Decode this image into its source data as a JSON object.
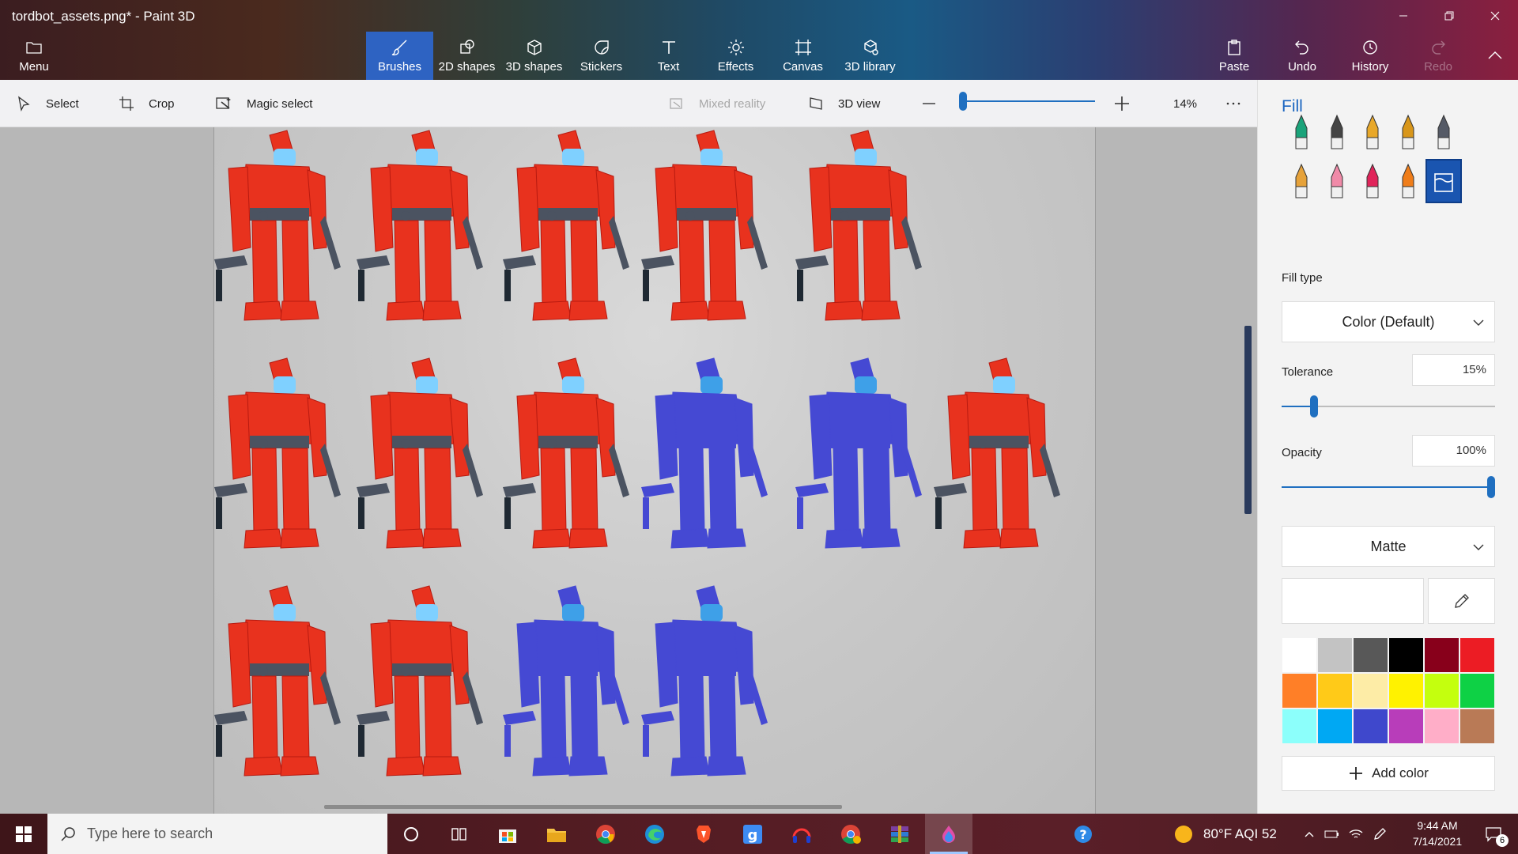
{
  "window": {
    "title": "tordbot_assets.png* - Paint 3D",
    "controls": [
      "minimize-icon",
      "restore-icon",
      "close-icon"
    ]
  },
  "ribbon": {
    "menu_label": "Menu",
    "tabs": [
      {
        "label": "Brushes",
        "icon": "brush-icon",
        "active": true
      },
      {
        "label": "2D shapes",
        "icon": "shapes-2d-icon"
      },
      {
        "label": "3D shapes",
        "icon": "cube-icon"
      },
      {
        "label": "Stickers",
        "icon": "sticker-icon"
      },
      {
        "label": "Text",
        "icon": "text-icon"
      },
      {
        "label": "Effects",
        "icon": "sun-icon"
      },
      {
        "label": "Canvas",
        "icon": "canvas-icon"
      },
      {
        "label": "3D library",
        "icon": "library-icon"
      }
    ],
    "right": {
      "paste_label": "Paste",
      "undo_label": "Undo",
      "history_label": "History",
      "redo_label": "Redo"
    }
  },
  "toolbar": {
    "select_label": "Select",
    "crop_label": "Crop",
    "magic_select_label": "Magic select",
    "mixed_reality_label": "Mixed reality",
    "view_3d_label": "3D view",
    "zoom_value": "14%",
    "zoom_level": 0.02
  },
  "canvas": {
    "robots": [
      {
        "row": 1,
        "col": 1,
        "color": "#e8321e"
      },
      {
        "row": 1,
        "col": 2,
        "color": "#e8321e"
      },
      {
        "row": 1,
        "col": 3,
        "color": "#e8321e"
      },
      {
        "row": 1,
        "col": 4,
        "color": "#e8321e"
      },
      {
        "row": 1,
        "col": 5,
        "color": "#e8321e"
      },
      {
        "row": 2,
        "col": 1,
        "color": "#e8321e"
      },
      {
        "row": 2,
        "col": 2,
        "color": "#e8321e"
      },
      {
        "row": 2,
        "col": 3,
        "color": "#e8321e"
      },
      {
        "row": 2,
        "col": 4,
        "color": "#4549d3"
      },
      {
        "row": 2,
        "col": 5,
        "color": "#4549d3"
      },
      {
        "row": 2,
        "col": 6,
        "color": "#e8321e"
      },
      {
        "row": 3,
        "col": 1,
        "color": "#e8321e"
      },
      {
        "row": 3,
        "col": 2,
        "color": "#e8321e"
      },
      {
        "row": 3,
        "col": 3,
        "color": "#4549d3"
      },
      {
        "row": 3,
        "col": 4,
        "color": "#4549d3"
      }
    ]
  },
  "panel": {
    "title": "Fill",
    "brushes": [
      {
        "name": "marker",
        "color": "#1aa37a"
      },
      {
        "name": "calligraphy-pen",
        "color": "#444444"
      },
      {
        "name": "oil-brush",
        "color": "#e8a82a"
      },
      {
        "name": "watercolor",
        "color": "#d8961a"
      },
      {
        "name": "pixel-pen",
        "color": "#555a66"
      },
      {
        "name": "pencil",
        "color": "#e6a23a"
      },
      {
        "name": "eraser",
        "color": "#f08aa8"
      },
      {
        "name": "crayon",
        "color": "#e0245a"
      },
      {
        "name": "spray-can",
        "color": "#ef7d1a"
      },
      {
        "name": "fill-bucket",
        "color": "#1a55b0",
        "selected": true
      }
    ],
    "fill_type_label": "Fill type",
    "fill_type_value": "Color (Default)",
    "tolerance_label": "Tolerance",
    "tolerance_value": "15%",
    "tolerance_level": 0.15,
    "opacity_label": "Opacity",
    "opacity_value": "100%",
    "opacity_level": 1.0,
    "finish_value": "Matte",
    "palette": [
      "#ffffff",
      "#c3c3c3",
      "#585858",
      "#000000",
      "#88001b",
      "#ec1c24",
      "#ff7f27",
      "#ffca18",
      "#fdeca6",
      "#fff200",
      "#c4ff0e",
      "#0ed145",
      "#8cfffb",
      "#00a8f3",
      "#3f48cc",
      "#b83dba",
      "#ffaec8",
      "#b97a56"
    ],
    "add_color_label": "Add color"
  },
  "taskbar": {
    "search_placeholder": "Type here to search",
    "apps": [
      "cortana-icon",
      "task-view-icon",
      "store-icon",
      "file-explorer-icon",
      "chrome-icon",
      "edge-icon",
      "brave-icon",
      "g-app-icon",
      "headset-icon",
      "chrome-profile-icon",
      "winrar-icon",
      "paint3d-icon"
    ],
    "help_icon": "help-icon",
    "weather": "80°F  AQI 52",
    "time": "9:44 AM",
    "date": "7/14/2021",
    "notification_count": "6"
  }
}
